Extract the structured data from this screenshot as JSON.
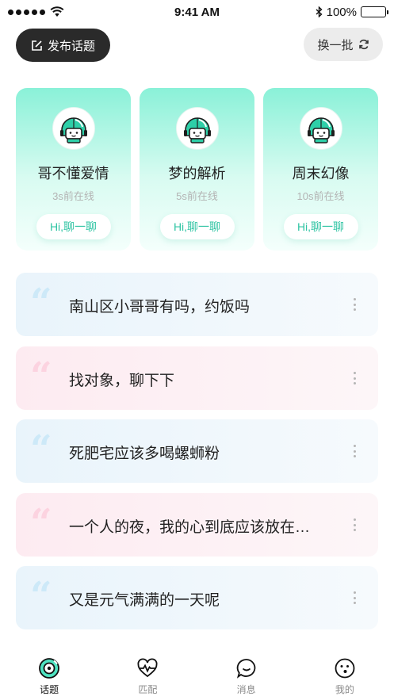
{
  "status_bar": {
    "time": "9:41 AM",
    "battery": "100%"
  },
  "header": {
    "publish_label": "发布话题",
    "refresh_label": "换一批"
  },
  "users": [
    {
      "name": "哥不懂爱情",
      "status": "3s前在线",
      "chat_label": "Hi,聊一聊"
    },
    {
      "name": "梦的解析",
      "status": "5s前在线",
      "chat_label": "Hi,聊一聊"
    },
    {
      "name": "周末幻像",
      "status": "10s前在线",
      "chat_label": "Hi,聊一聊"
    }
  ],
  "topics": [
    {
      "text": "南山区小哥哥有吗，约饭吗",
      "tone": "blue"
    },
    {
      "text": "找对象，聊下下",
      "tone": "pink"
    },
    {
      "text": "死肥宅应该多喝螺蛳粉",
      "tone": "blue"
    },
    {
      "text": "一个人的夜，我的心到底应该放在…",
      "tone": "pink"
    },
    {
      "text": "又是元气满满的一天呢",
      "tone": "blue"
    }
  ],
  "tabs": [
    {
      "label": "话题",
      "icon": "topic-icon",
      "active": true
    },
    {
      "label": "匹配",
      "icon": "match-icon",
      "active": false
    },
    {
      "label": "消息",
      "icon": "message-icon",
      "active": false
    },
    {
      "label": "我的",
      "icon": "profile-icon",
      "active": false
    }
  ],
  "colors": {
    "accent": "#2fc4a3",
    "card_gradient_top": "#8af1d8",
    "dark_button": "#2a2a2a"
  }
}
